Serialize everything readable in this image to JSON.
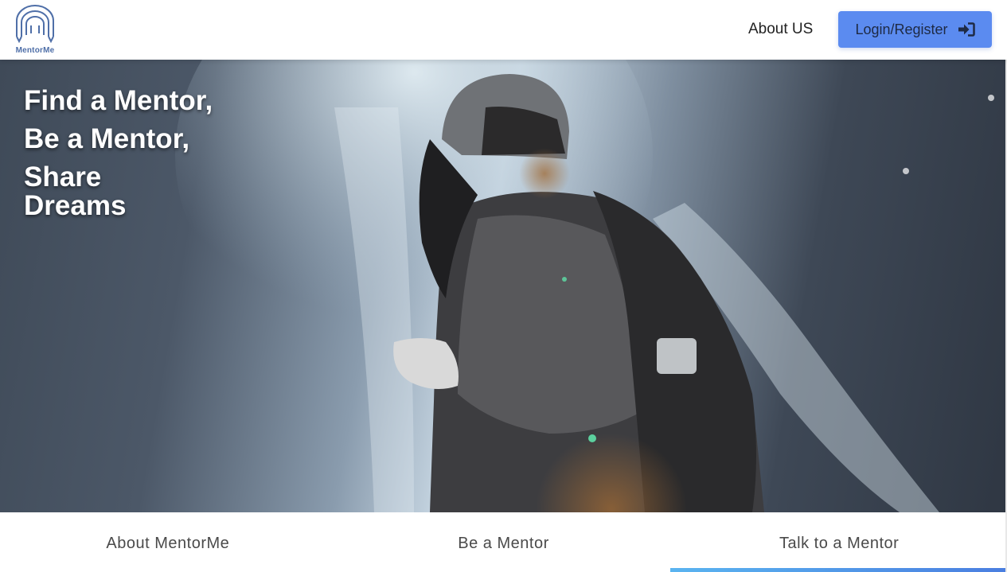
{
  "header": {
    "logo_text": "MentorMe",
    "nav_about": "About US",
    "login_label": "Login/Register"
  },
  "hero": {
    "headline": [
      "Find a Mentor,",
      "Be a Mentor,",
      "Share",
      "Dreams"
    ]
  },
  "tabs": [
    {
      "label": "About MentorMe",
      "active": false
    },
    {
      "label": "Be a Mentor",
      "active": false
    },
    {
      "label": "Talk to a Mentor",
      "active": true
    }
  ],
  "colors": {
    "accent": "#5b8bf0",
    "logo": "#4f6fa8",
    "tab_indicator": "#4a7ee0"
  },
  "icons": {
    "logo": "arch-pencils-logo-icon",
    "login": "sign-in-icon"
  }
}
